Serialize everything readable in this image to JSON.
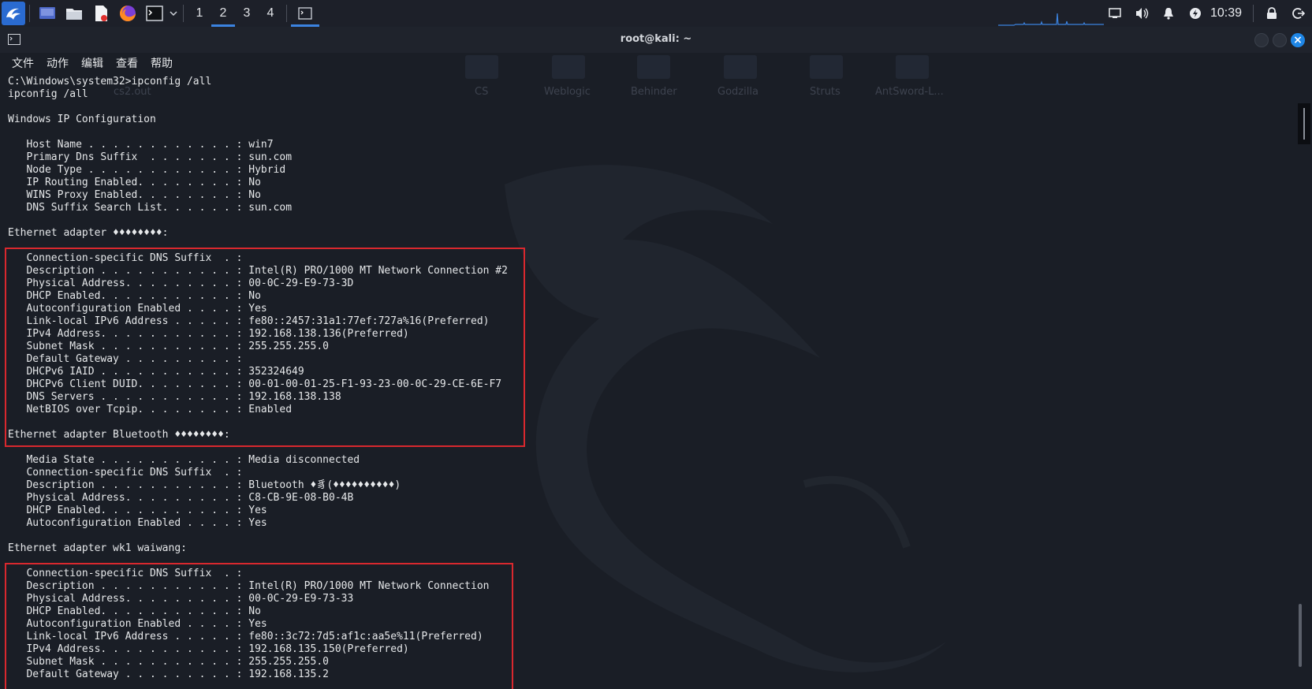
{
  "taskbar": {
    "workspaces": [
      {
        "label": "1",
        "active": false
      },
      {
        "label": "2",
        "active": true
      },
      {
        "label": "3",
        "active": false
      },
      {
        "label": "4",
        "active": false
      }
    ],
    "clock": "10:39",
    "launchers": [
      "desktop-icon",
      "file-manager-icon",
      "text-editor-icon",
      "firefox-icon",
      "terminal-icon"
    ]
  },
  "window": {
    "title": "root@kali: ~",
    "menu": [
      "文件",
      "动作",
      "编辑",
      "查看",
      "帮助"
    ]
  },
  "background_labels": {
    "file": "cs2.out",
    "folders": [
      "CS",
      "Weblogic",
      "Behinder",
      "Godzilla",
      "Struts",
      "AntSword-L..."
    ]
  },
  "terminal": {
    "lines": [
      "C:\\Windows\\system32>ipconfig /all",
      "ipconfig /all",
      "",
      "Windows IP Configuration",
      "",
      "   Host Name . . . . . . . . . . . . : win7",
      "   Primary Dns Suffix  . . . . . . . : sun.com",
      "   Node Type . . . . . . . . . . . . : Hybrid",
      "   IP Routing Enabled. . . . . . . . : No",
      "   WINS Proxy Enabled. . . . . . . . : No",
      "   DNS Suffix Search List. . . . . . : sun.com",
      "",
      "Ethernet adapter ♦♦♦♦♦♦♦♦:",
      "",
      "   Connection-specific DNS Suffix  . :",
      "   Description . . . . . . . . . . . : Intel(R) PRO/1000 MT Network Connection #2",
      "   Physical Address. . . . . . . . . : 00-0C-29-E9-73-3D",
      "   DHCP Enabled. . . . . . . . . . . : No",
      "   Autoconfiguration Enabled . . . . : Yes",
      "   Link-local IPv6 Address . . . . . : fe80::2457:31a1:77ef:727a%16(Preferred)",
      "   IPv4 Address. . . . . . . . . . . : 192.168.138.136(Preferred)",
      "   Subnet Mask . . . . . . . . . . . : 255.255.255.0",
      "   Default Gateway . . . . . . . . . :",
      "   DHCPv6 IAID . . . . . . . . . . . : 352324649",
      "   DHCPv6 Client DUID. . . . . . . . : 00-01-00-01-25-F1-93-23-00-0C-29-CE-6E-F7",
      "   DNS Servers . . . . . . . . . . . : 192.168.138.138",
      "   NetBIOS over Tcpip. . . . . . . . : Enabled",
      "",
      "Ethernet adapter Bluetooth ♦♦♦♦♦♦♦♦:",
      "",
      "   Media State . . . . . . . . . . . : Media disconnected",
      "   Connection-specific DNS Suffix  . :",
      "   Description . . . . . . . . . . . : Bluetooth ♦豸(♦♦♦♦♦♦♦♦♦♦)",
      "   Physical Address. . . . . . . . . : C8-CB-9E-08-B0-4B",
      "   DHCP Enabled. . . . . . . . . . . : Yes",
      "   Autoconfiguration Enabled . . . . : Yes",
      "",
      "Ethernet adapter wk1 waiwang:",
      "",
      "   Connection-specific DNS Suffix  . :",
      "   Description . . . . . . . . . . . : Intel(R) PRO/1000 MT Network Connection",
      "   Physical Address. . . . . . . . . : 00-0C-29-E9-73-33",
      "   DHCP Enabled. . . . . . . . . . . : No",
      "   Autoconfiguration Enabled . . . . : Yes",
      "   Link-local IPv6 Address . . . . . : fe80::3c72:7d5:af1c:aa5e%11(Preferred)",
      "   IPv4 Address. . . . . . . . . . . : 192.168.135.150(Preferred)",
      "   Subnet Mask . . . . . . . . . . . : 255.255.255.0",
      "   Default Gateway . . . . . . . . . : 192.168.135.2"
    ]
  },
  "colors": {
    "highlight": "#d9282e",
    "accent": "#3b83e0",
    "close_button": "#1e86e6",
    "terminal_bg": "#1a1e26"
  }
}
